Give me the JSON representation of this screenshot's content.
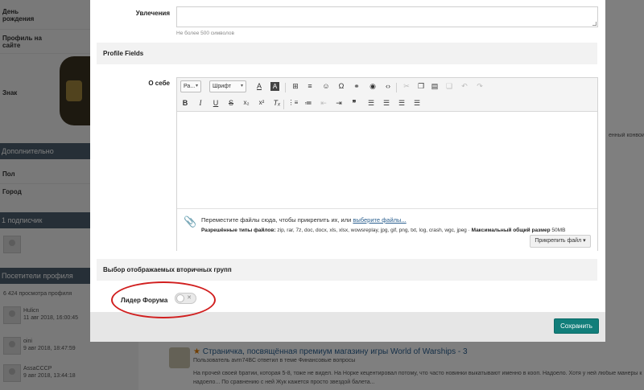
{
  "background": {
    "sidebar": {
      "rows": [
        {
          "label_line1": "День",
          "label_line2": "рождения"
        },
        {
          "label_line1": "Профиль на",
          "label_line2": "сайте"
        },
        {
          "label_line1": "Знак",
          "label_line2": ""
        }
      ],
      "section_additional": "Дополнительно",
      "field_gender": "Пол",
      "field_city": "Город",
      "section_followers": "1 подписчик",
      "section_visitors": "Посетители профиля",
      "views": "6 424 просмотра профиля",
      "visitors": [
        {
          "name": "Hulicn",
          "date": "11 авг 2018, 16:00:45"
        },
        {
          "name": "oini",
          "date": "9 авг 2018, 18:47:59"
        },
        {
          "name": "AssaCCCP",
          "date": "9 авг 2018, 13:44:18"
        }
      ]
    },
    "right_peek": "енный конвои",
    "activity": {
      "title": "Страничка, посвящённая премиум магазину игры World of Warships - 3",
      "subtitle": "Пользователь avm74BC ответил в теме Финансовые вопросы",
      "snippet_1": "На прочей своей братии, которая 5-8, тоже не видел. На Норке кецентировал потому, что часто новинки выкатывают именно в кооп. Надоело. Хотя у ней любые манеры к",
      "snippet_2": "надоело... По сравнению с ней Жук кажется просто звездой балета..."
    }
  },
  "modal": {
    "interests_label": "Увлечения",
    "interests_value": "",
    "interests_hint": "Не более 500 символов",
    "profile_fields_title": "Profile Fields",
    "about_label": "О себе",
    "toolbar": {
      "size_select": "Ра...",
      "font_select": "Шрифт"
    },
    "attachments": {
      "drop_text": "Переместите файлы сюда, чтобы прикрепить их, или",
      "choose_link": "выберите файлы...",
      "types_label": "Разрешённые типы файлов:",
      "types_list": "zip, rar, 7z, doc, docx, xls, xlsx, wowsreplay, jpg, gif, png, txt, log, crash, wgc, jpeg",
      "max_size_label": "Максимальный общий размер",
      "max_size_value": "50MB",
      "attach_button": "Прикрепить файл ▾"
    },
    "secondary_groups_title": "Выбор отображаемых вторичных групп",
    "toggle_label": "Лидер Форума",
    "toggle_on": false,
    "save_button": "Сохранить"
  },
  "colors": {
    "accent": "#127e7a",
    "sidebar_header": "#4c5e6e",
    "annotation": "#d11f1f"
  }
}
